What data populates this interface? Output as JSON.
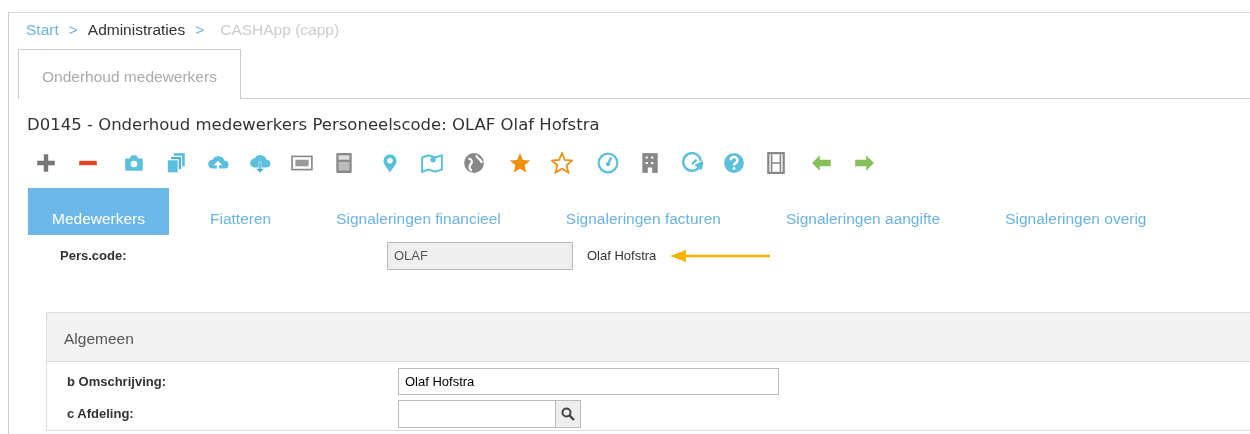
{
  "breadcrumb": [
    {
      "label": "Start",
      "kind": "link"
    },
    {
      "label": ">",
      "kind": "separator"
    },
    {
      "label": "Administraties",
      "kind": "text"
    },
    {
      "label": ">",
      "kind": "separator"
    },
    {
      "label": "CASHApp (capp)",
      "kind": "current"
    }
  ],
  "page_tabs": [
    {
      "label": "Onderhoud medewerkers",
      "selected": true
    }
  ],
  "title": "D0145 - Onderhoud medewerkers Personeelscode: OLAF Olaf Hofstra",
  "nav_tabs": [
    {
      "label": "Medewerkers",
      "selected": true
    },
    {
      "label": "Fiatteren",
      "selected": false
    },
    {
      "label": "Signaleringen financieel",
      "selected": false
    },
    {
      "label": "Signaleringen facturen",
      "selected": false
    },
    {
      "label": "Signaleringen aangifte",
      "selected": false
    },
    {
      "label": "Signaleringen overig",
      "selected": false
    }
  ],
  "pers_code": {
    "label": "Pers.code:",
    "value": "OLAF",
    "name": "Olaf Hofstra"
  },
  "section": {
    "title": "Algemeen",
    "fields": [
      {
        "label": "b Omschrijving:",
        "value": "Olaf Hofstra",
        "kind": "text"
      },
      {
        "label": "c Afdeling:",
        "kind": "lookup"
      }
    ]
  }
}
